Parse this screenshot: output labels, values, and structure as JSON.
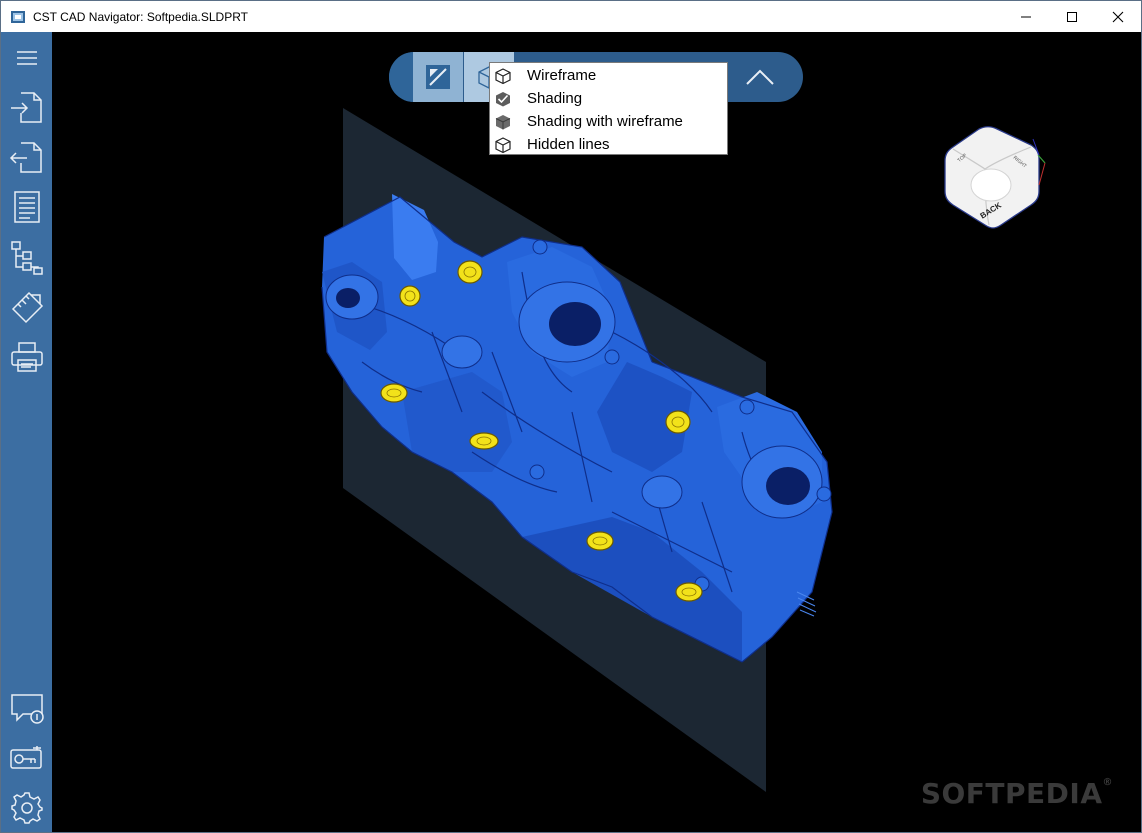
{
  "window": {
    "title": "CST CAD Navigator: Softpedia.SLDPRT",
    "controls": [
      "minimize-icon",
      "maximize-icon",
      "close-icon"
    ]
  },
  "sidebar": {
    "top_items": [
      {
        "name": "menu",
        "icon": "hamburger-icon"
      },
      {
        "name": "import",
        "icon": "import-icon"
      },
      {
        "name": "export",
        "icon": "export-icon"
      },
      {
        "name": "properties",
        "icon": "document-icon"
      },
      {
        "name": "structure",
        "icon": "tree-icon"
      },
      {
        "name": "measure",
        "icon": "measure-icon"
      },
      {
        "name": "print",
        "icon": "printer-icon"
      }
    ],
    "bottom_items": [
      {
        "name": "feedback",
        "icon": "chat-info-icon"
      },
      {
        "name": "license",
        "icon": "key-icon"
      },
      {
        "name": "settings",
        "icon": "gear-icon"
      }
    ]
  },
  "toolbar": {
    "buttons": [
      "view-mode-icon",
      "render-mode-icon",
      "collapse-chevron-icon"
    ]
  },
  "render_menu": {
    "items": [
      {
        "label": "Wireframe",
        "icon": "cube-outline-icon",
        "checked": false
      },
      {
        "label": "Shading",
        "icon": "check-icon",
        "checked": true
      },
      {
        "label": "Shading with wireframe",
        "icon": "cube-solid-icon",
        "checked": false
      },
      {
        "label": "Hidden lines",
        "icon": "cube-outline-icon",
        "checked": false
      }
    ]
  },
  "viewcube": {
    "faces": [
      "BACK",
      "RIGHT",
      "TOP"
    ]
  },
  "watermark": {
    "text": "SOFTPEDIA",
    "mark": "®"
  },
  "colors": {
    "sidebar": "#3c6ea2",
    "toolbar": "#2d5c8c",
    "model": "#2563d9",
    "model_dark": "#0f2e8a",
    "holes": "#f2e21a",
    "plane": "#1c2733"
  }
}
